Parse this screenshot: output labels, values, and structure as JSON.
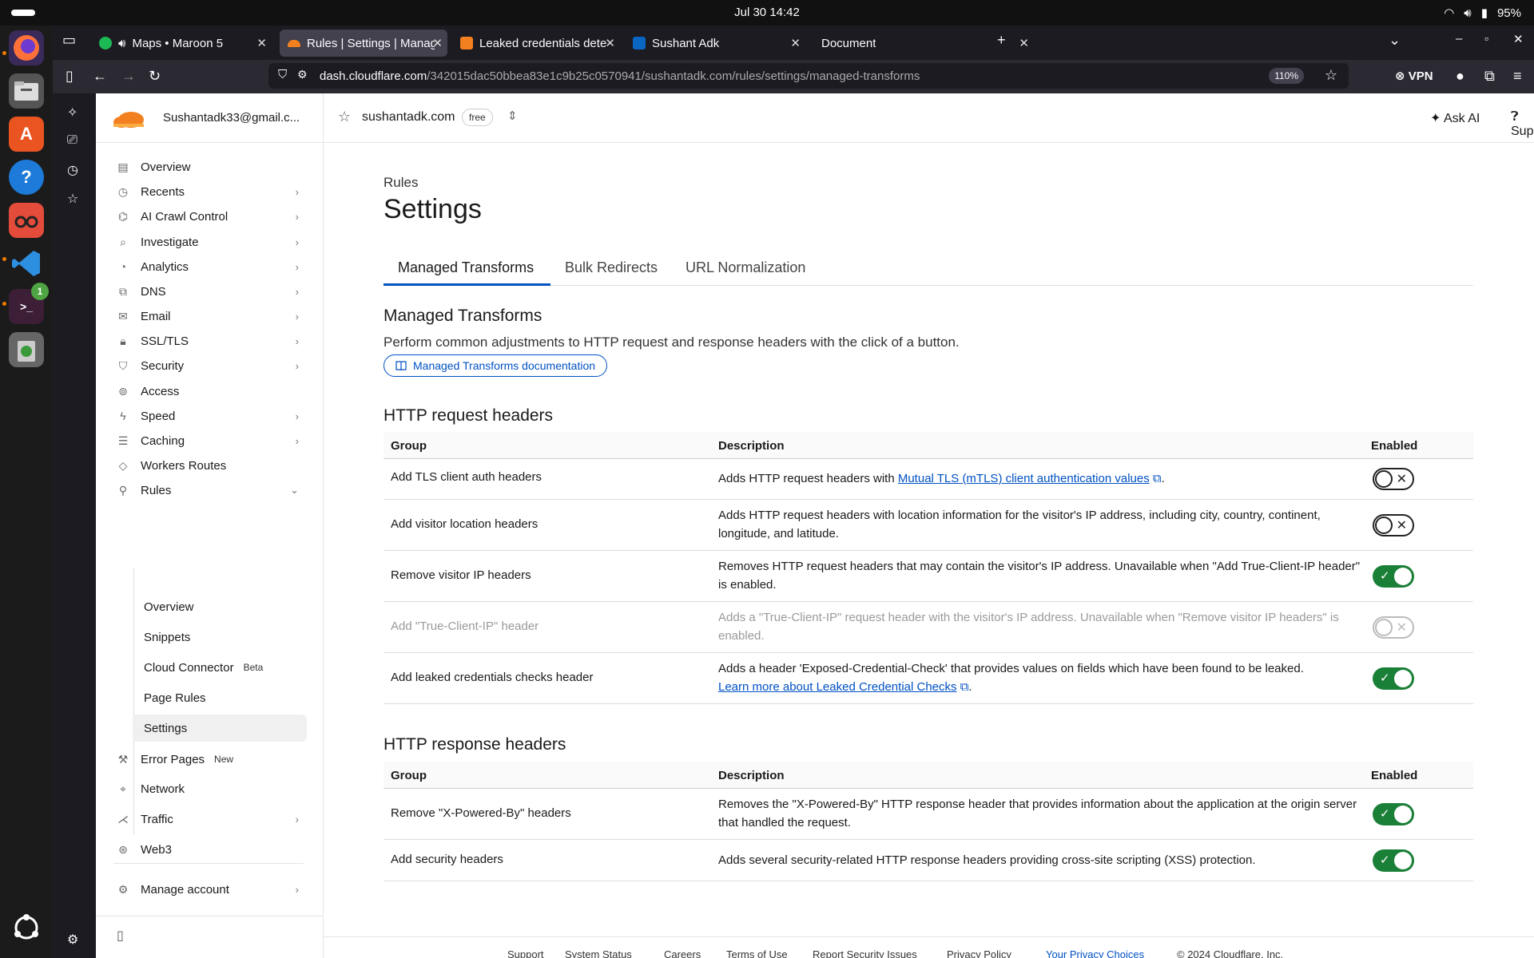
{
  "os": {
    "clock": "Jul 30  14:42",
    "battery": "95%"
  },
  "browser": {
    "tabs": [
      {
        "label": "Maps • Maroon 5",
        "color": "#1db954"
      },
      {
        "label": "Rules | Settings | Manage",
        "color": "#f38020"
      },
      {
        "label": "Leaked credentials detec",
        "color": "#f38020"
      },
      {
        "label": "Sushant Adk",
        "color": "#0a66c2"
      },
      {
        "label": "Document",
        "color": "#2b2a33"
      }
    ],
    "url_host": "dash.cloudflare.com",
    "url_path": "/342015dac50bbea83e1c9b25c0570941/sushantadk.com/rules/settings/managed-transforms",
    "zoom": "110%",
    "vpn": "VPN",
    "dock_badge": "1"
  },
  "sidebar": {
    "account": "Sushantadk33@gmail.c...",
    "items": [
      {
        "label": "Overview"
      },
      {
        "label": "Recents"
      },
      {
        "label": "AI Crawl Control"
      },
      {
        "label": "Investigate"
      },
      {
        "label": "Analytics"
      },
      {
        "label": "DNS"
      },
      {
        "label": "Email"
      },
      {
        "label": "SSL/TLS"
      },
      {
        "label": "Security"
      },
      {
        "label": "Access"
      },
      {
        "label": "Speed"
      },
      {
        "label": "Caching"
      },
      {
        "label": "Workers Routes"
      },
      {
        "label": "Rules"
      }
    ],
    "rules_sub": [
      {
        "label": "Overview"
      },
      {
        "label": "Snippets"
      },
      {
        "label": "Cloud Connector",
        "badge": "Beta"
      },
      {
        "label": "Page Rules"
      },
      {
        "label": "Settings"
      }
    ],
    "items_after": [
      {
        "label": "Error Pages",
        "badge": "New"
      },
      {
        "label": "Network"
      },
      {
        "label": "Traffic"
      },
      {
        "label": "Web3"
      }
    ],
    "manage_account": "Manage account"
  },
  "topbar": {
    "zone": "sushantadk.com",
    "plan": "free",
    "ask_ai": "Ask AI",
    "support": "Support"
  },
  "main": {
    "breadcrumb": "Rules",
    "title": "Settings",
    "tabs": [
      "Managed Transforms",
      "Bulk Redirects",
      "URL Normalization"
    ],
    "section_title": "Managed Transforms",
    "section_desc": "Perform common adjustments to HTTP request and response headers with the click of a button.",
    "doc_link": "Managed Transforms documentation",
    "request": {
      "title": "HTTP request headers",
      "col_group": "Group",
      "col_desc": "Description",
      "col_enabled": "Enabled",
      "rows": [
        {
          "group": "Add TLS client auth headers",
          "desc": "Adds HTTP request headers with",
          "link": "Mutual TLS (mTLS) client authentication values",
          "after": ".",
          "enabled": "off"
        },
        {
          "group": "Add visitor location headers",
          "desc": "Adds HTTP request headers with location information for the visitor's IP address, including city, country, continent, longitude, and latitude.",
          "enabled": "off"
        },
        {
          "group": "Remove visitor IP headers",
          "desc": "Removes HTTP request headers that may contain the visitor's IP address. Unavailable when \"Add True-Client-IP header\" is enabled.",
          "enabled": "on"
        },
        {
          "group": "Add \"True-Client-IP\" header",
          "desc": "Adds a \"True-Client-IP\" request header with the visitor's IP address. Unavailable when \"Remove visitor IP headers\" is enabled.",
          "enabled": "disabled"
        },
        {
          "group": "Add leaked credentials checks header",
          "desc": "Adds a header 'Exposed-Credential-Check' that provides values on fields which have been found to be leaked.",
          "link": "Learn more about Leaked Credential Checks",
          "after": ".",
          "enabled": "on"
        }
      ]
    },
    "response": {
      "title": "HTTP response headers",
      "col_group": "Group",
      "col_desc": "Description",
      "col_enabled": "Enabled",
      "rows": [
        {
          "group": "Remove \"X-Powered-By\" headers",
          "desc": "Removes the \"X-Powered-By\" HTTP response header that provides information about the application at the origin server that handled the request.",
          "enabled": "on"
        },
        {
          "group": "Add security headers",
          "desc": "Adds several security-related HTTP response headers providing cross-site scripting (XSS) protection.",
          "enabled": "on"
        }
      ]
    }
  },
  "footer": [
    "Support",
    "System Status",
    "Careers",
    "Terms of Use",
    "Report Security Issues",
    "Privacy Policy",
    "Your Privacy Choices",
    "© 2024 Cloudflare, Inc."
  ]
}
